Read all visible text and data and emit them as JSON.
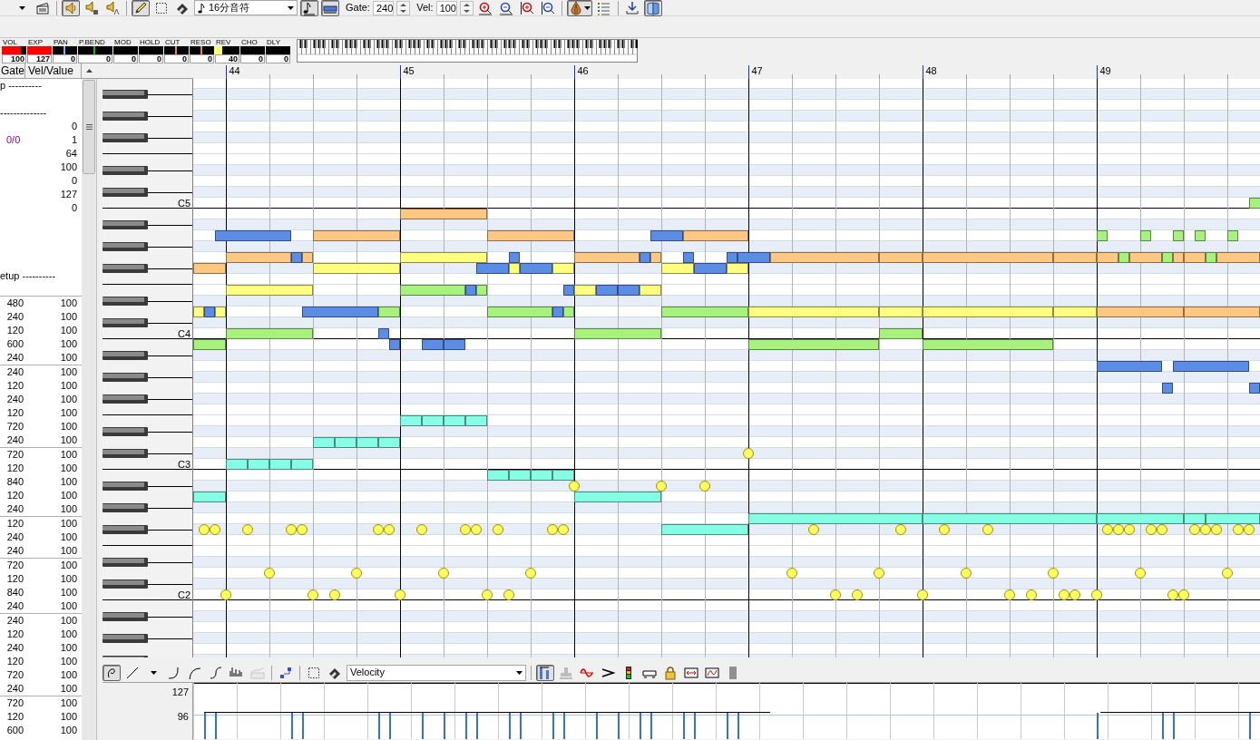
{
  "top_toolbar": {
    "buttons": [
      {
        "pressed": false
      },
      {
        "pressed": false
      },
      {
        "pressed": true
      },
      {
        "pressed": false
      },
      {
        "pressed": false
      },
      {
        "pressed": true
      },
      {
        "pressed": false
      },
      {
        "pressed": false
      },
      {
        "pressed": true
      },
      {
        "pressed": true
      },
      {
        "pressed": false
      },
      {
        "pressed": false
      },
      {
        "pressed": false
      },
      {
        "pressed": false
      },
      {
        "pressed": true
      },
      {
        "pressed": false
      },
      {
        "pressed": false
      },
      {
        "pressed": true
      }
    ],
    "note_length": "16分音符",
    "gate_label": "Gate:",
    "gate_value": "240",
    "vel_label": "Vel:",
    "vel_value": "100"
  },
  "meters": [
    {
      "label": "VOL",
      "value": "100",
      "kind": "bar",
      "level": 0.79,
      "color": "#ff0000"
    },
    {
      "label": "EXP",
      "value": "127",
      "kind": "bar",
      "level": 1,
      "color": "#ff0000"
    },
    {
      "label": "PAN",
      "value": "0",
      "kind": "center",
      "color": "#80b0ff"
    },
    {
      "label": "P.BEND",
      "value": "0",
      "kind": "center",
      "color": "#00c000"
    },
    {
      "label": "MOD",
      "value": "0",
      "kind": "bar"
    },
    {
      "label": "HOLD",
      "value": "0",
      "kind": "bar"
    },
    {
      "label": "CUT",
      "value": "0",
      "kind": "center",
      "color": "#e09030"
    },
    {
      "label": "RESO",
      "value": "0",
      "kind": "center",
      "color": "#e09030"
    },
    {
      "label": "REV",
      "value": "40",
      "kind": "bar",
      "level": 0.31,
      "color": "#ffff60"
    },
    {
      "label": "CHO",
      "value": "0",
      "kind": "bar"
    },
    {
      "label": "DLY",
      "value": "0",
      "kind": "bar"
    }
  ],
  "event_list": {
    "columns": [
      "Gate",
      "Vel/Value"
    ],
    "section_1": "p ----------",
    "dash_line": "--------------",
    "values": [
      {
        "value": "0"
      },
      {
        "extra": "0/0",
        "value": "1"
      },
      {
        "value": "64"
      },
      {
        "value": "100"
      },
      {
        "value": "0"
      },
      {
        "value": "127"
      },
      {
        "value": "0"
      }
    ],
    "section_2": "etup ----------",
    "groups": [
      {
        "rows": [
          {
            "gate": "480",
            "vel": "100"
          },
          {
            "gate": "240",
            "vel": "100"
          },
          {
            "gate": "120",
            "vel": "100"
          },
          {
            "gate": "600",
            "vel": "100"
          },
          {
            "gate": "240",
            "vel": "100"
          }
        ]
      },
      {
        "rows": [
          {
            "gate": "240",
            "vel": "100"
          },
          {
            "gate": "120",
            "vel": "100"
          },
          {
            "gate": "240",
            "vel": "100"
          },
          {
            "gate": "120",
            "vel": "100"
          },
          {
            "gate": "720",
            "vel": "100"
          },
          {
            "gate": "240",
            "vel": "100"
          }
        ]
      },
      {
        "rows": [
          {
            "gate": "720",
            "vel": "100"
          },
          {
            "gate": "120",
            "vel": "100"
          },
          {
            "gate": "840",
            "vel": "100"
          },
          {
            "gate": "120",
            "vel": "100"
          },
          {
            "gate": "240",
            "vel": "100"
          }
        ]
      },
      {
        "rows": [
          {
            "gate": "120",
            "vel": "100"
          },
          {
            "gate": "240",
            "vel": "100"
          },
          {
            "gate": "240",
            "vel": "100"
          }
        ]
      },
      {
        "rows": [
          {
            "gate": "720",
            "vel": "100"
          },
          {
            "gate": "120",
            "vel": "100"
          },
          {
            "gate": "840",
            "vel": "100"
          },
          {
            "gate": "240",
            "vel": "100"
          }
        ]
      },
      {
        "rows": [
          {
            "gate": "240",
            "vel": "100"
          },
          {
            "gate": "120",
            "vel": "100"
          },
          {
            "gate": "240",
            "vel": "100"
          },
          {
            "gate": "120",
            "vel": "100"
          },
          {
            "gate": "720",
            "vel": "100"
          },
          {
            "gate": "240",
            "vel": "100"
          }
        ]
      },
      {
        "rows": [
          {
            "gate": "720",
            "vel": "100"
          },
          {
            "gate": "120",
            "vel": "100"
          },
          {
            "gate": "600",
            "vel": "100"
          }
        ]
      }
    ]
  },
  "ruler": {
    "measures": [
      "44",
      "45",
      "46",
      "47",
      "48",
      "49"
    ]
  },
  "keyboard": {
    "labels": [
      "C5",
      "C4",
      "C3",
      "C2"
    ]
  },
  "bottom_toolbar": {
    "buttons": [
      {
        "pressed": true,
        "disabled": false
      },
      {
        "pressed": false,
        "disabled": false
      },
      {
        "pressed": false,
        "disabled": false
      },
      {
        "pressed": false,
        "disabled": false
      },
      {
        "pressed": false,
        "disabled": false
      },
      {
        "pressed": false,
        "disabled": false
      },
      {
        "pressed": false,
        "disabled": false
      },
      {
        "pressed": false,
        "disabled": true
      },
      {
        "pressed": false,
        "disabled": false
      },
      {
        "pressed": false,
        "disabled": false
      },
      {
        "pressed": false,
        "disabled": false
      },
      {
        "pressed": true,
        "disabled": false
      },
      {
        "pressed": false,
        "disabled": true
      },
      {
        "pressed": false,
        "disabled": false
      },
      {
        "pressed": false,
        "disabled": false
      },
      {
        "pressed": false,
        "disabled": false
      },
      {
        "pressed": false,
        "disabled": false
      },
      {
        "pressed": false,
        "disabled": false
      },
      {
        "pressed": false,
        "disabled": false
      },
      {
        "pressed": false,
        "disabled": false
      },
      {
        "pressed": false,
        "disabled": false
      }
    ],
    "controller": "Velocity"
  },
  "velocity_pane": {
    "axis_labels": [
      "127",
      "96"
    ]
  }
}
